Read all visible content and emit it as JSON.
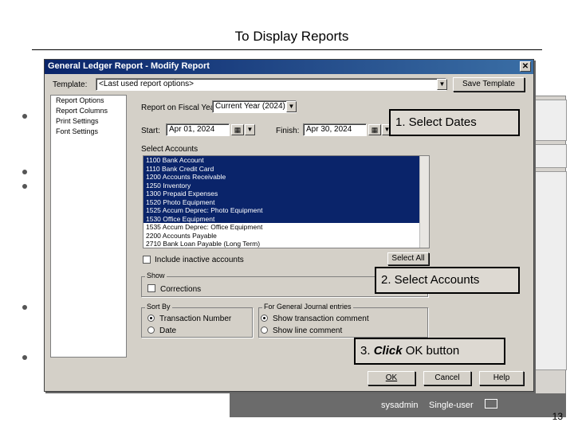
{
  "slide": {
    "title": "To Display Reports",
    "page_number": "13"
  },
  "background_app": {
    "user": "sysadmin",
    "mode": "Single-user",
    "mail_icon": "mail-icon"
  },
  "dialog": {
    "title": "General Ledger Report - Modify Report",
    "template_label": "Template:",
    "template_value": "<Last used report options>",
    "save_template_label": "Save Template",
    "tree_items": [
      "Report Options",
      "Report Columns",
      "Print Settings",
      "Font Settings"
    ],
    "fiscal_year_label": "Report on Fiscal Year:",
    "fiscal_year_value": "Current Year (2024)",
    "start_label": "Start:",
    "start_value": "Apr 01, 2024",
    "finish_label": "Finish:",
    "finish_value": "Apr 30, 2024",
    "select_accounts_label": "Select Accounts",
    "accounts": [
      {
        "text": "1100 Bank Account",
        "selected": true
      },
      {
        "text": "1110 Bank Credit Card",
        "selected": true
      },
      {
        "text": "1200 Accounts Receivable",
        "selected": true
      },
      {
        "text": "1250 Inventory",
        "selected": true
      },
      {
        "text": "1300 Prepaid Expenses",
        "selected": true
      },
      {
        "text": "1520 Photo Equipment",
        "selected": true
      },
      {
        "text": "1525 Accum Deprec: Photo Equipment",
        "selected": true
      },
      {
        "text": "1530 Office Equipment",
        "selected": true
      },
      {
        "text": "1535 Accum Deprec: Office Equipment",
        "selected": false
      },
      {
        "text": "2200 Accounts Payable",
        "selected": false
      },
      {
        "text": "2710 Bank Loan Payable (Long Term)",
        "selected": false
      }
    ],
    "include_inactive_label": "Include inactive accounts",
    "select_all_label": "Select All",
    "show_label": "Show",
    "corrections_label": "Corrections",
    "sort_by_label": "Sort By",
    "sort_transaction_number": "Transaction Number",
    "sort_date": "Date",
    "gj_entries_label": "For General Journal entries",
    "show_transaction_comment": "Show transaction comment",
    "show_line_comment": "Show line comment",
    "ok_label": "OK",
    "cancel_label": "Cancel",
    "help_label": "Help"
  },
  "callouts": {
    "step1": "1. Select Dates",
    "step2": "2. Select Accounts",
    "step3_prefix": "3. ",
    "step3_emph": "Click",
    "step3_suffix": " OK button"
  }
}
